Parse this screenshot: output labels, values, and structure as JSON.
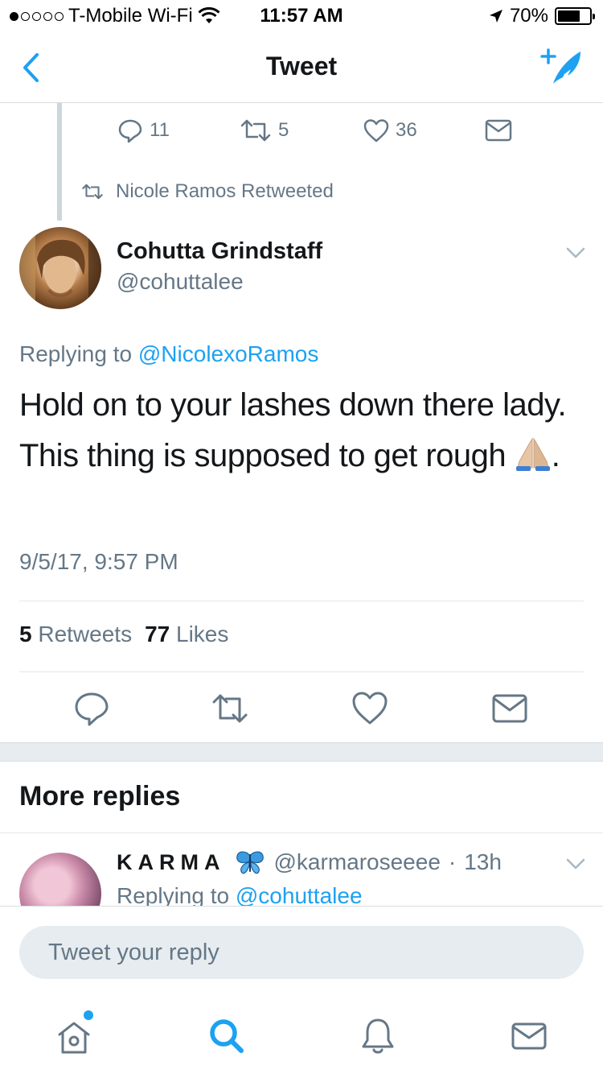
{
  "status_bar": {
    "carrier": "T-Mobile Wi-Fi",
    "time": "11:57 AM",
    "battery": "70%",
    "battery_level": 0.7,
    "signal_bars": 1,
    "signal_max": 5
  },
  "nav": {
    "title": "Tweet",
    "back_icon": "chevron-left-icon",
    "compose_icon": "compose-tweet-icon"
  },
  "previous_tweet_actions": {
    "reply_count": "11",
    "retweet_count": "5",
    "like_count": "36"
  },
  "retweet_context": {
    "text": "Nicole Ramos Retweeted"
  },
  "tweet": {
    "author_name": "Cohutta Grindstaff",
    "author_handle": "@cohuttalee",
    "replying_prefix": "Replying to ",
    "replying_to": "@NicolexoRamos",
    "text": "Hold on to your lashes down there lady. This thing is supposed to get rough",
    "text_suffix": ".",
    "timestamp": "9/5/17, 9:57 PM",
    "retweets_count": "5",
    "retweets_label": "Retweets",
    "likes_count": "77",
    "likes_label": "Likes"
  },
  "more_replies": {
    "heading": "More replies",
    "reply": {
      "author_name": "KARMA",
      "author_handle": "@karmaroseeee",
      "separator": "·",
      "time": "13h",
      "replying_prefix": "Replying to ",
      "replying_to": "@cohuttalee"
    }
  },
  "compose": {
    "placeholder": "Tweet your reply"
  },
  "colors": {
    "accent": "#1da1f2",
    "secondary_text": "#657786",
    "primary_text": "#14171a",
    "divider": "#e1e8ed"
  }
}
